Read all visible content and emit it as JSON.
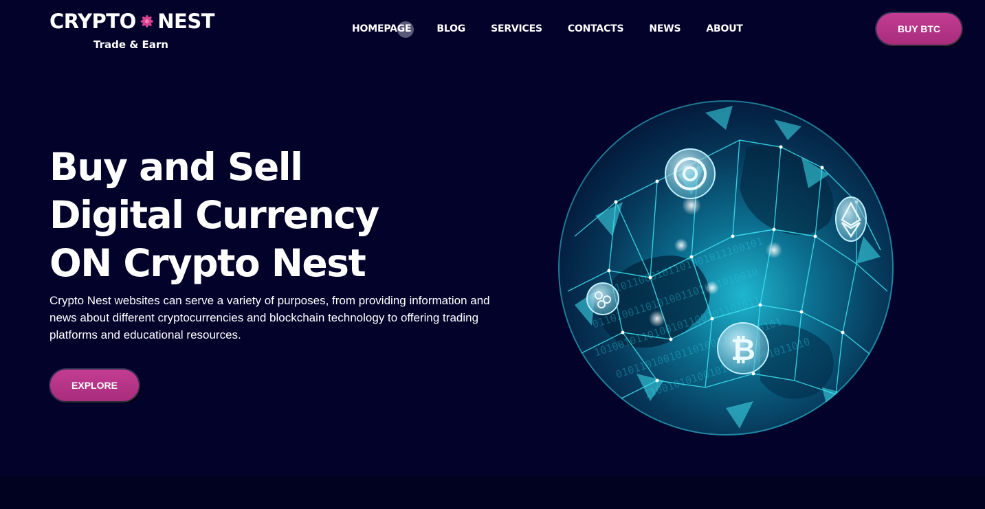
{
  "brand": {
    "name_left": "CRYPTO",
    "name_right": "NEST",
    "tagline": "Trade & Earn",
    "accent": "#c33d93"
  },
  "nav": {
    "items": [
      {
        "label": "HOMEPAGE"
      },
      {
        "label": "BLOG"
      },
      {
        "label": "SERVICES"
      },
      {
        "label": "CONTACTS"
      },
      {
        "label": "NEWS"
      },
      {
        "label": "ABOUT"
      }
    ],
    "cta_label": "BUY BTC"
  },
  "hero": {
    "title_lines": [
      "Buy and Sell",
      "Digital Currency",
      "ON Crypto Nest"
    ],
    "description": "Crypto Nest websites can serve a variety of purposes, from providing information and news about different cryptocurrencies and blockchain technology to offering trading platforms and educational resources.",
    "button_label": "EXPLORE",
    "illustration": "crypto-globe-icon"
  },
  "colors": {
    "background": "#02022b",
    "globe_cyan": "#35d6e8",
    "button_pink": "#c33d93"
  }
}
